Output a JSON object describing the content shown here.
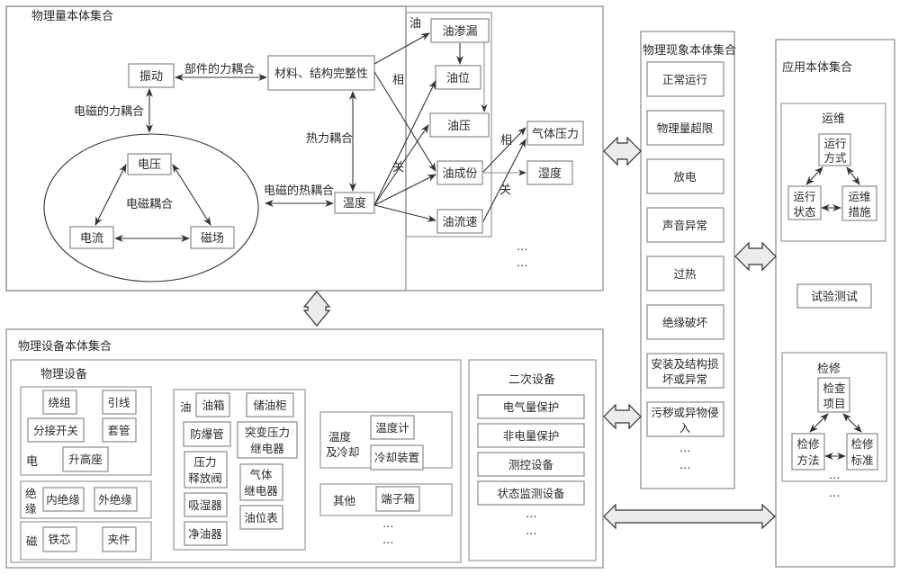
{
  "physical_quantity_set": {
    "title": "物理量本体集合",
    "nodes": {
      "vibration": "振动",
      "material": "材料、结构完整性",
      "voltage": "电压",
      "current": "电流",
      "magnetic": "磁场",
      "temperature": "温度"
    },
    "edge_labels": {
      "component_force": "部件的力耦合",
      "em_force": "电磁的力耦合",
      "thermal_force": "热力耦合",
      "em_thermal": "电磁的热耦合",
      "em_coupling": "电磁耦合",
      "related_1a": "相",
      "related_1b": "关",
      "related_2a": "相",
      "related_2b": "关"
    },
    "oil_group": {
      "label": "油",
      "items": [
        "油渗漏",
        "油位",
        "油压",
        "油成份",
        "油流速"
      ]
    },
    "gas_pressure": "气体压力",
    "humidity": "湿度",
    "ellipsis": [
      "…",
      "…"
    ]
  },
  "phenomenon_set": {
    "title": "物理现象本体集合",
    "items": [
      "正常运行",
      "物理量超限",
      "放电",
      "声音异常",
      "过热",
      "绝缘破坏",
      "安装及结构损坏或异常",
      "污秽或异物侵入"
    ],
    "ellipsis": [
      "…",
      "…"
    ]
  },
  "application_set": {
    "title": "应用本体集合",
    "ops": {
      "title": "运维",
      "top": "运行方式",
      "left": "运行状态",
      "right": "运维措施"
    },
    "test": "试验测试",
    "maintenance": {
      "title": "检修",
      "top": "检查项目",
      "left": "检修方法",
      "right": "检修标准",
      "ellipsis": "…"
    },
    "ellipsis": "…"
  },
  "equipment_set": {
    "title": "物理设备本体集合",
    "primary": {
      "title": "物理设备",
      "electric": {
        "label": "电",
        "items": [
          "绕组",
          "引线",
          "分接开关",
          "套管",
          "升高座"
        ]
      },
      "insulation": {
        "label": "绝缘",
        "items": [
          "内绝缘",
          "外绝缘"
        ]
      },
      "magnetic": {
        "label": "磁",
        "items": [
          "铁芯",
          "夹件"
        ]
      },
      "oil": {
        "label": "油",
        "items": [
          "油箱",
          "储油柜",
          "防爆管",
          "突变压力继电器",
          "压力释放阀",
          "气体继电器",
          "吸湿器",
          "油位表",
          "净油器"
        ]
      },
      "temp_cooling": {
        "label": "温度及冷却",
        "items": [
          "温度计",
          "冷却装置"
        ]
      },
      "other": {
        "label": "其他",
        "items": [
          "端子箱"
        ]
      },
      "ellipsis": [
        "…",
        "…"
      ]
    },
    "secondary": {
      "title": "二次设备",
      "items": [
        "电气量保护",
        "非电量保护",
        "测控设备",
        "状态监测设备"
      ],
      "ellipsis": [
        "…",
        "…"
      ]
    }
  }
}
